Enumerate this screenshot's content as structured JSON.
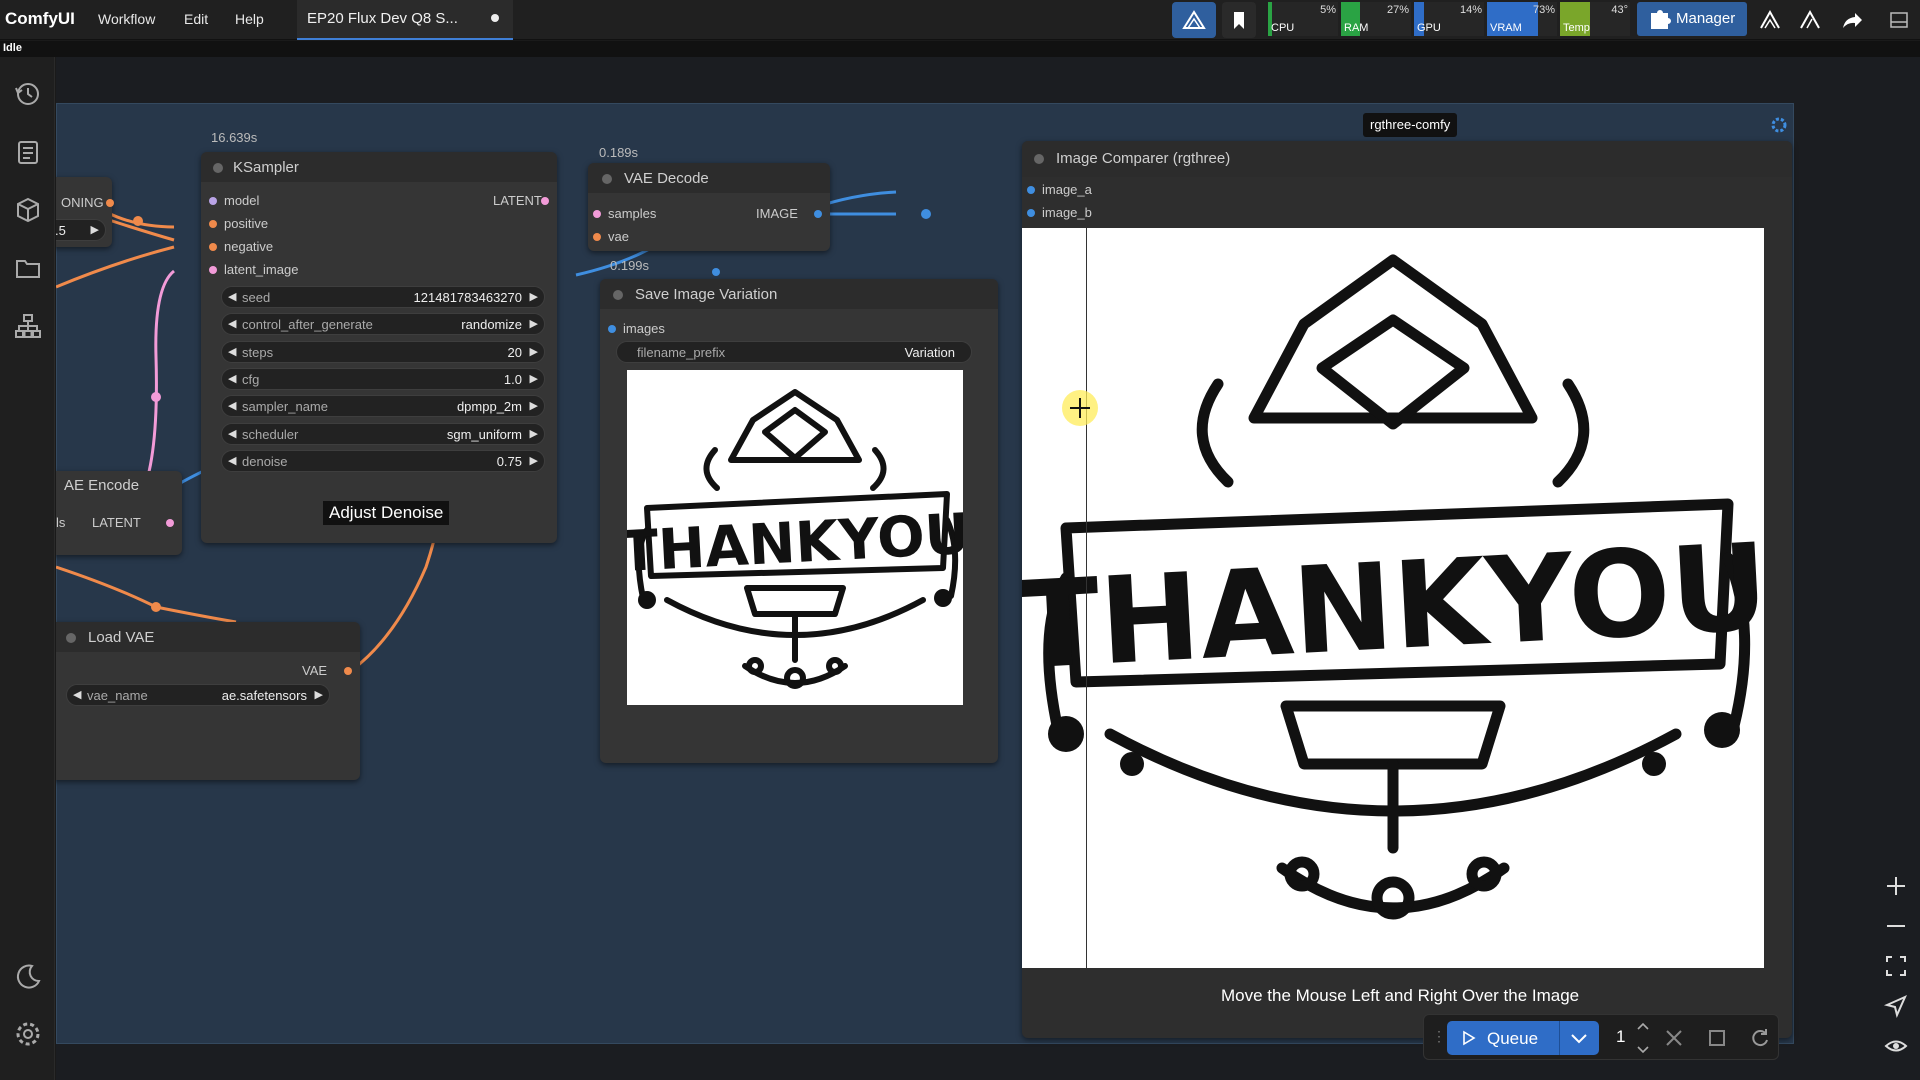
{
  "app": {
    "brand": "ComfyUI",
    "status": "Idle"
  },
  "menu": {
    "workflow": "Workflow",
    "edit": "Edit",
    "help": "Help"
  },
  "workflow_tab": {
    "title": "EP20 Flux Dev Q8 S..."
  },
  "monitors": [
    {
      "label": "CPU",
      "value": "5%",
      "fill": 0.05,
      "color": "#2aa344"
    },
    {
      "label": "RAM",
      "value": "27%",
      "fill": 0.27,
      "color": "#2aa344"
    },
    {
      "label": "GPU",
      "value": "14%",
      "fill": 0.14,
      "color": "#2f6dc7"
    },
    {
      "label": "VRAM",
      "value": "73%",
      "fill": 0.73,
      "color": "#2f6dc7"
    },
    {
      "label": "Temp",
      "value": "43°",
      "fill": 0.43,
      "color": "#7aa62a"
    }
  ],
  "manager": {
    "label": "Manager"
  },
  "group_badge": "rgthree-comfy",
  "nodes": {
    "ksampler": {
      "title": "KSampler",
      "timing": "16.639s",
      "inputs": [
        "model",
        "positive",
        "negative",
        "latent_image"
      ],
      "output": "LATENT",
      "widgets": [
        {
          "name": "seed",
          "value": "121481783463270"
        },
        {
          "name": "control_after_generate",
          "value": "randomize"
        },
        {
          "name": "steps",
          "value": "20"
        },
        {
          "name": "cfg",
          "value": "1.0"
        },
        {
          "name": "sampler_name",
          "value": "dpmpp_2m"
        },
        {
          "name": "scheduler",
          "value": "sgm_uniform"
        },
        {
          "name": "denoise",
          "value": "0.75"
        }
      ]
    },
    "vae_decode": {
      "title": "VAE Decode",
      "timing": "0.189s",
      "inputs": [
        "samples",
        "vae"
      ],
      "output": "IMAGE"
    },
    "save_image": {
      "title": "Save Image Variation",
      "timing": "0.199s",
      "input": "images",
      "widget_name": "filename_prefix",
      "widget_value": "Variation"
    },
    "image_comparer": {
      "title": "Image Comparer (rgthree)",
      "inputs": [
        "image_a",
        "image_b"
      ]
    },
    "load_vae": {
      "title": "Load VAE",
      "output": "VAE",
      "widget_name": "vae_name",
      "widget_value": "ae.safetensors"
    },
    "vae_encode": {
      "title": "AE Encode",
      "input": "ls",
      "output": "LATENT"
    },
    "conditioning_partial": {
      "output": "ONING",
      "widget_value": ".5"
    }
  },
  "captions": {
    "adjust_denoise": "Adjust Denoise",
    "move_mouse": "Move the Mouse Left and Right Over the Image"
  },
  "artwork_text": "THANKYOU",
  "queue": {
    "label": "Queue",
    "count": "1"
  }
}
